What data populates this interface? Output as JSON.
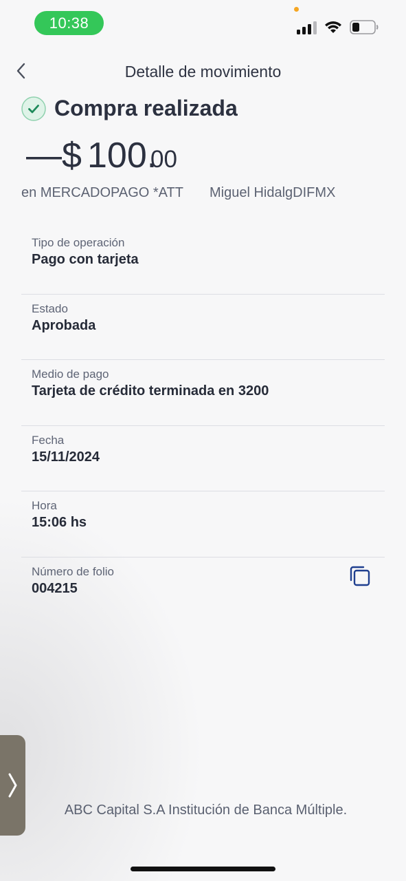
{
  "status_bar": {
    "time": "10:38"
  },
  "nav": {
    "title": "Detalle de movimiento"
  },
  "header": {
    "status_title": "Compra realizada",
    "amount_sign": "—",
    "amount_currency": "$",
    "amount_whole": "100.",
    "amount_cents": "00",
    "merchant": "en MERCADOPAGO *ATT",
    "payee": "Miguel HidalgDIFMX"
  },
  "details": [
    {
      "label": "Tipo de operación",
      "value": "Pago con tarjeta"
    },
    {
      "label": "Estado",
      "value": "Aprobada"
    },
    {
      "label": "Medio de pago",
      "value": "Tarjeta de crédito terminada en 3200"
    },
    {
      "label": "Fecha",
      "value": "15/11/2024"
    },
    {
      "label": "Hora",
      "value": "15:06 hs"
    },
    {
      "label": "Número de folio",
      "value": "004215"
    }
  ],
  "footer": {
    "text": "ABC Capital S.A Institución de Banca Múltiple."
  },
  "colors": {
    "time_pill": "#34c759",
    "check_green": "#1e8a5a",
    "copy_icon_blue": "#1f3f8f",
    "background": "#f7f7f8"
  },
  "icons": {
    "back": "chevron-left-icon",
    "status": "check-circle-icon",
    "copy": "copy-icon",
    "handle": "chevron-right-icon"
  }
}
